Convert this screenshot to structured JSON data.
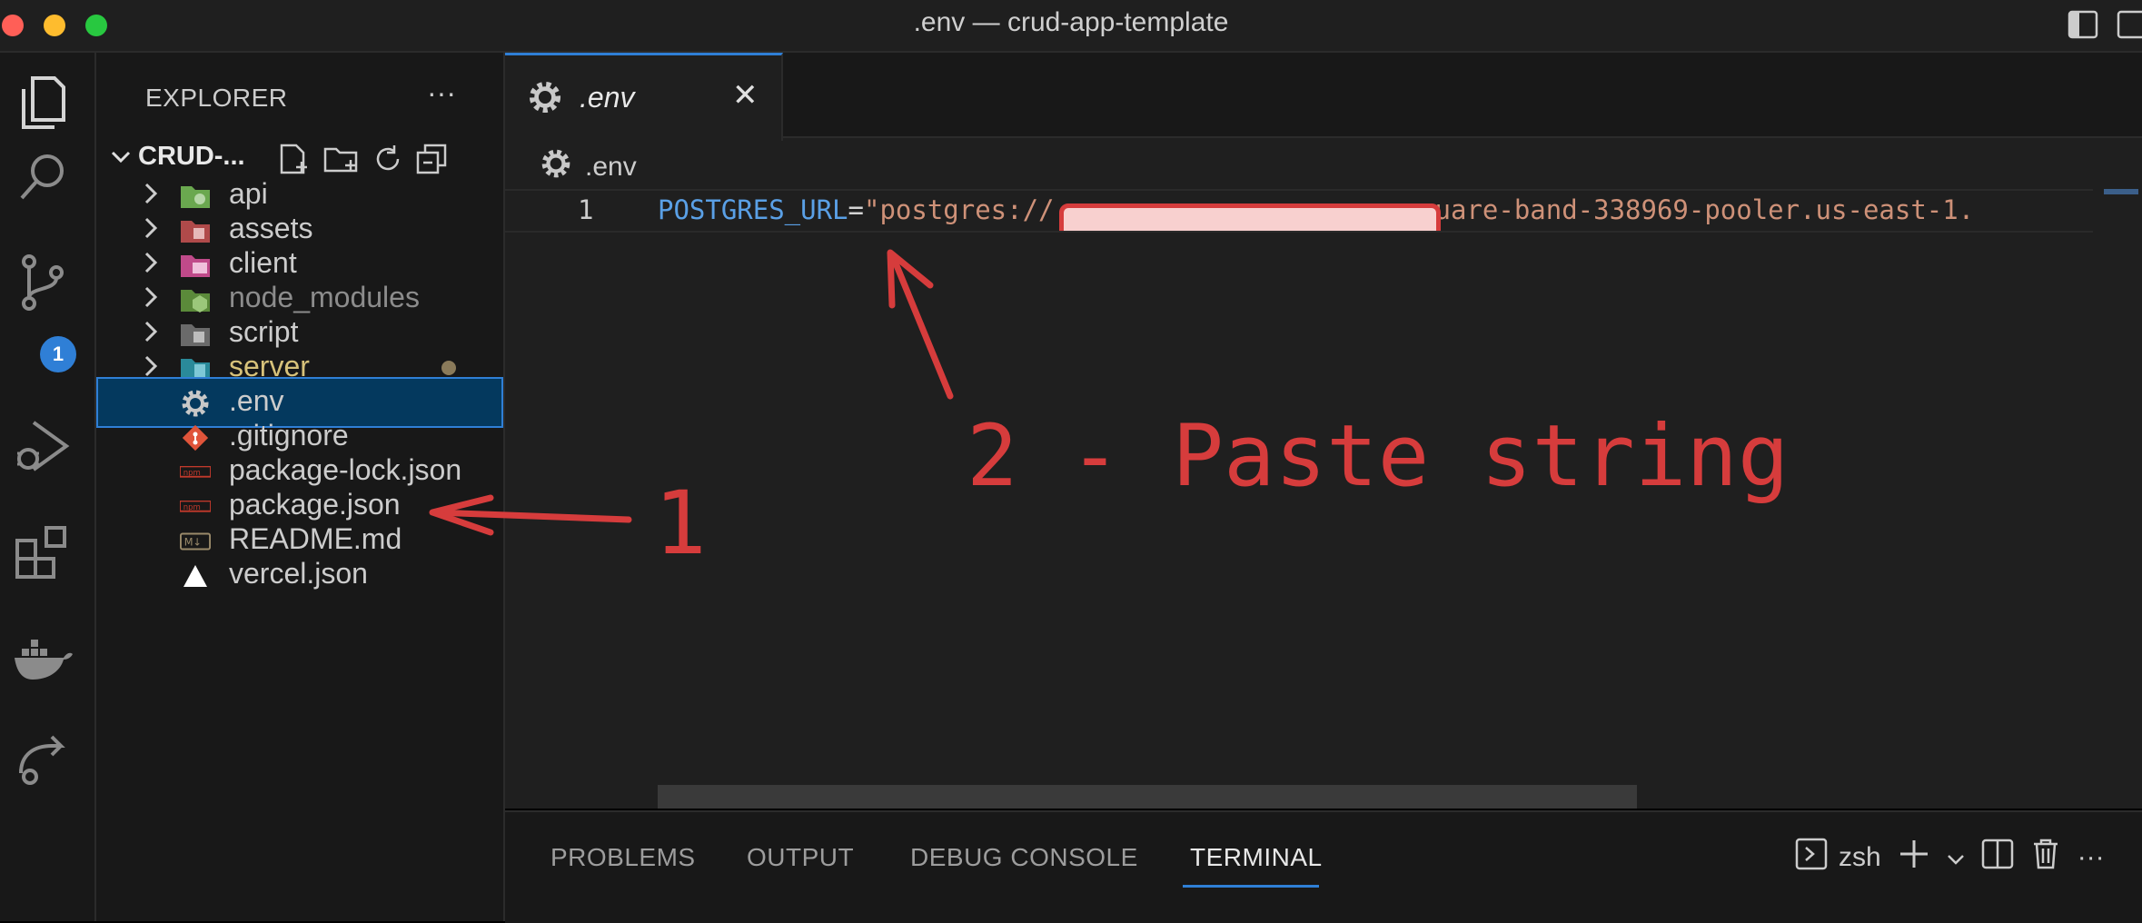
{
  "window": {
    "title": ".env — crud-app-template"
  },
  "colors": {
    "accent": "#2f7fd6",
    "annotation": "#d63c3c",
    "string": "#ce9178",
    "keyword": "#5aa0e6"
  },
  "activity_bar": {
    "scm_badge": "1"
  },
  "explorer": {
    "title": "EXPLORER",
    "more": "···",
    "folder_name": "CRUD-...",
    "items": [
      {
        "label": "api",
        "type": "folder",
        "icon": "api-folder-icon"
      },
      {
        "label": "assets",
        "type": "folder",
        "icon": "assets-folder-icon"
      },
      {
        "label": "client",
        "type": "folder",
        "icon": "client-folder-icon"
      },
      {
        "label": "node_modules",
        "type": "folder",
        "icon": "node-modules-folder-icon"
      },
      {
        "label": "script",
        "type": "folder",
        "icon": "script-folder-icon"
      },
      {
        "label": "server",
        "type": "folder",
        "icon": "server-folder-icon"
      },
      {
        "label": ".env",
        "type": "file",
        "icon": "gear-icon",
        "selected": true
      },
      {
        "label": ".gitignore",
        "type": "file",
        "icon": "git-icon"
      },
      {
        "label": "package-lock.json",
        "type": "file",
        "icon": "npm-icon"
      },
      {
        "label": "package.json",
        "type": "file",
        "icon": "npm-icon"
      },
      {
        "label": "README.md",
        "type": "file",
        "icon": "markdown-icon"
      },
      {
        "label": "vercel.json",
        "type": "file",
        "icon": "vercel-icon"
      }
    ]
  },
  "editor": {
    "tab_label": ".env",
    "breadcrumb": ".env",
    "line_number": "1",
    "code_key": "POSTGRES_URL",
    "code_eq": "=",
    "code_value_start": "\"postgres://",
    "code_value_end": "ep-square-band-338969-pooler.us-east-1."
  },
  "panel": {
    "tabs": [
      "PROBLEMS",
      "OUTPUT",
      "DEBUG CONSOLE",
      "TERMINAL"
    ],
    "active_tab": "TERMINAL",
    "shell": "zsh"
  },
  "annotations": {
    "step1": "1",
    "step2": "2 - Paste string"
  }
}
